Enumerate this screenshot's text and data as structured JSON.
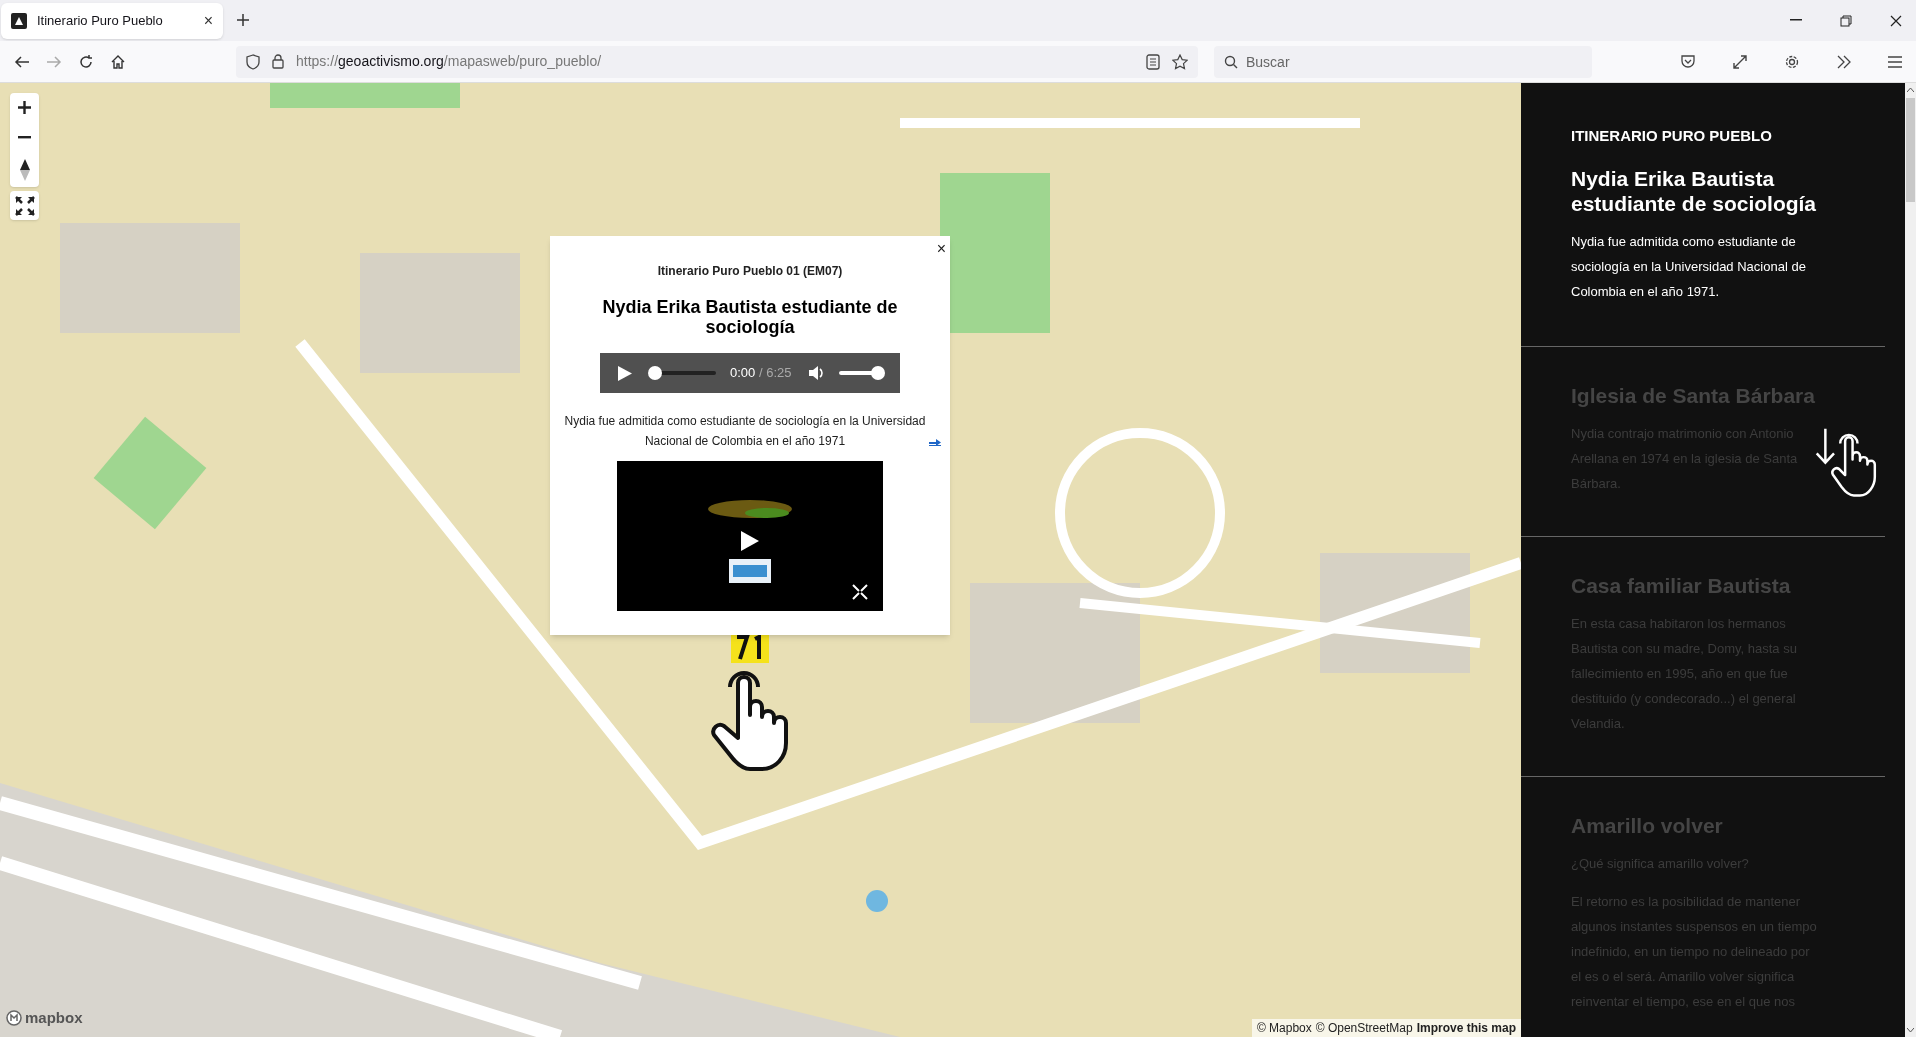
{
  "browser": {
    "tab": {
      "title": "Itinerario Puro Pueblo",
      "close": "×"
    },
    "url": {
      "scheme": "https://",
      "domain": "geoactivismo.org",
      "path": "/mapasweb/puro_pueblo/"
    },
    "search": {
      "placeholder": "Buscar"
    }
  },
  "map": {
    "logo": "mapbox",
    "attribution": [
      "© Mapbox",
      "© OpenStreetMap",
      "Improve this map"
    ]
  },
  "popup": {
    "close": "×",
    "eyebrow": "Itinerario Puro Pueblo 01 (EM07)",
    "title": "Nydia Erika Bautista estudiante de sociología",
    "audio": {
      "current": "0:00",
      "separator": "/",
      "duration": "6:25",
      "progress": {
        "level": 0
      },
      "volume": {
        "level": 1
      }
    },
    "text": "Nydia fue admitida como estudiante de sociología en la Universidad Nacional de Colombia en el año 1971"
  },
  "sidebar": {
    "heading": "ITINERARIO PURO PUEBLO",
    "sections": [
      {
        "title": "Nydia Erika Bautista estudiante de sociología",
        "paragraphs": [
          "Nydia fue admitida como estudiante de sociología en la Universidad Nacional de Colombia en el año 1971."
        ],
        "active": true
      },
      {
        "title": "Iglesia de Santa Bárbara",
        "paragraphs": [
          "Nydia contrajo matrimonio con Antonio Arellana en 1974 en la iglesia de Santa Bárbara."
        ],
        "active": false
      },
      {
        "title": "Casa familiar Bautista",
        "paragraphs": [
          "En esta casa habitaron los hermanos Bautista con su madre, Domy, hasta su fallecimiento en 1995, año en que fue destituido (y condecorado...) el general Velandia."
        ],
        "active": false
      },
      {
        "title": "Amarillo volver",
        "paragraphs": [
          "¿Qué significa amarillo volver?",
          "El retorno es la posibilidad de mantener algunos instantes suspensos en un tiempo indefinido, en un tiempo no delineado por el es o el será. Amarillo volver significa reinventar el tiempo, ese en el que nos"
        ],
        "active": false
      }
    ]
  }
}
